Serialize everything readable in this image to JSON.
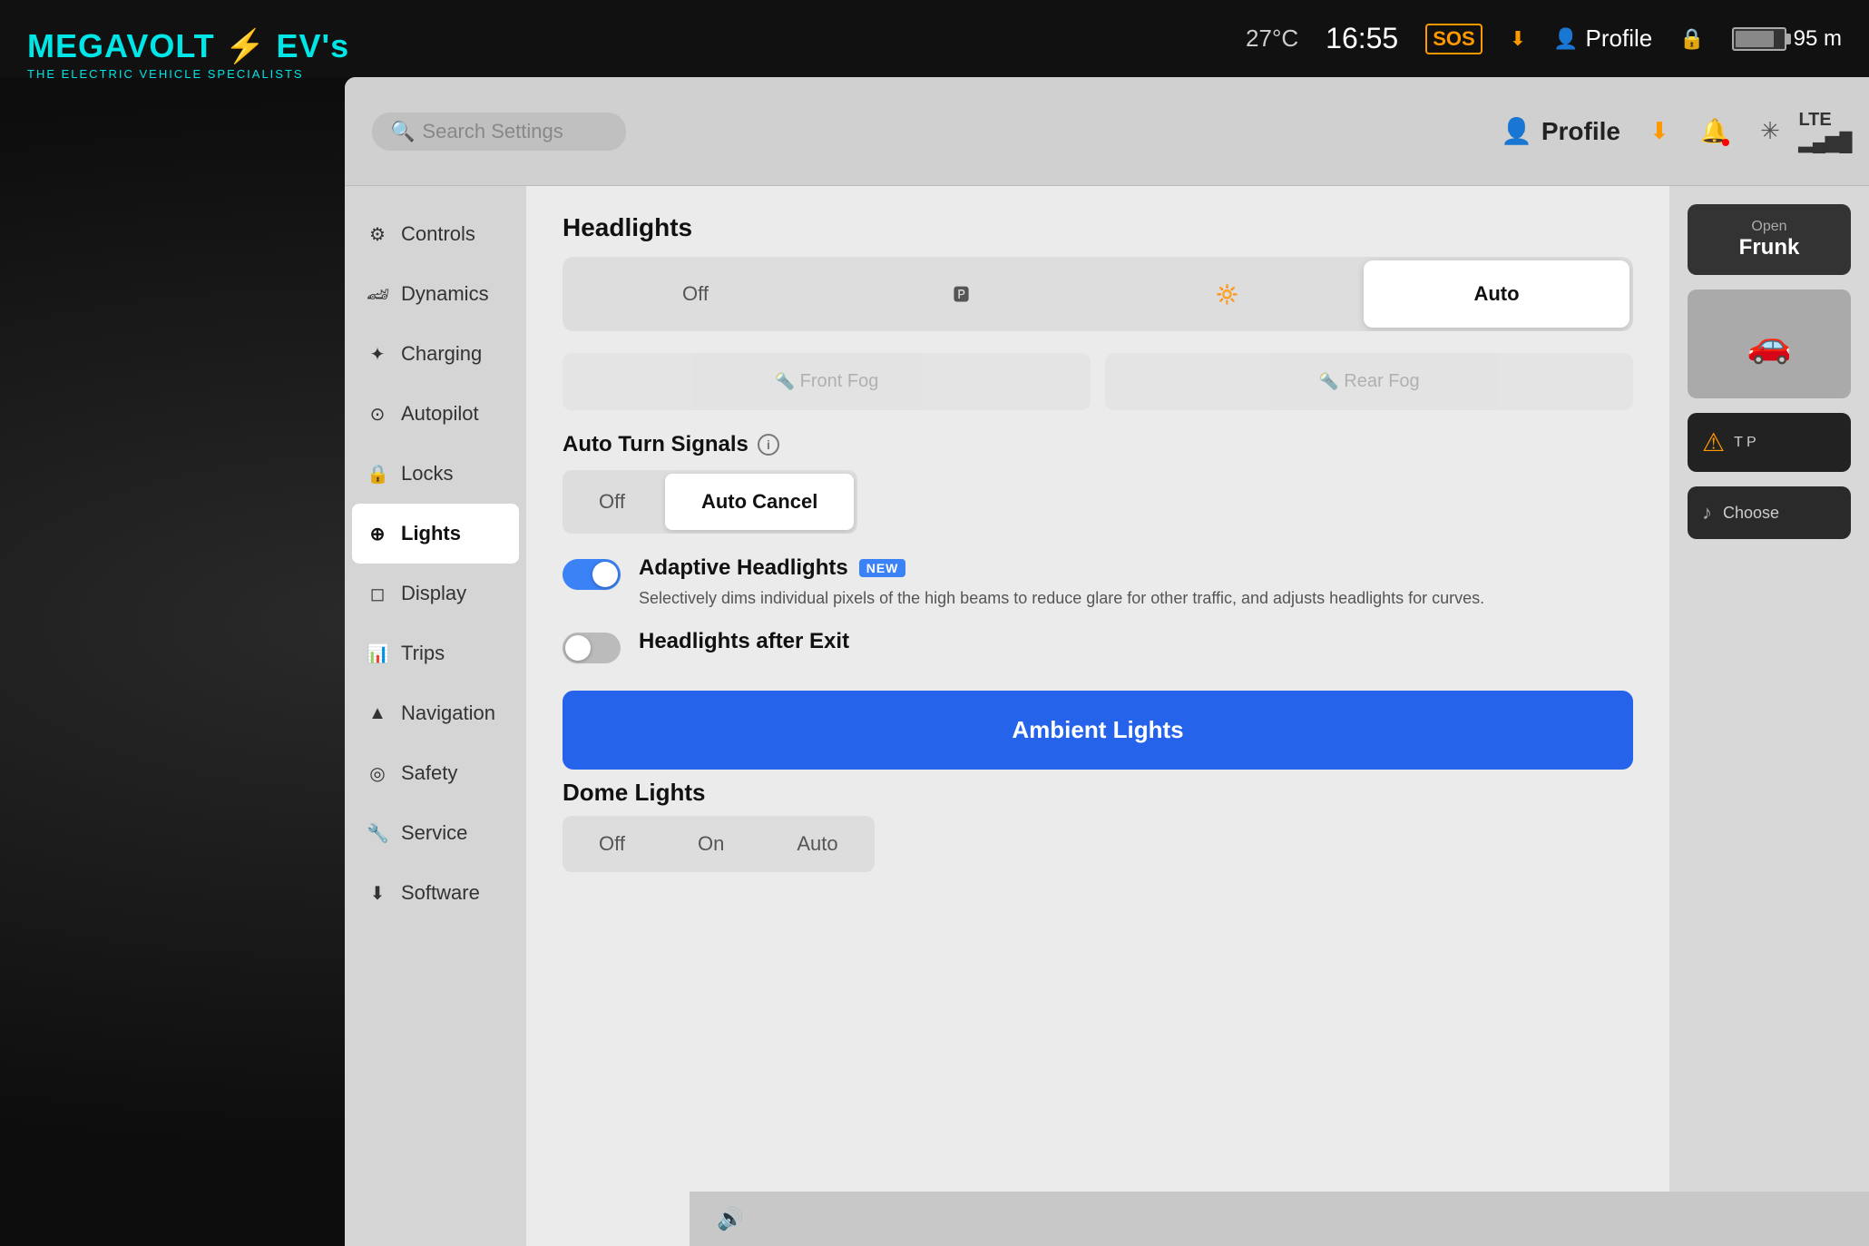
{
  "logo": {
    "brand": "MEGAVOLT ⚡ EV's",
    "subtitle": "THE ELECTRIC VEHICLE SPECIALISTS"
  },
  "status_bar": {
    "temperature": "27°C",
    "time": "16:55",
    "sos": "SOS",
    "profile": "Profile",
    "battery_pct": "95 m"
  },
  "tesla_header": {
    "search_placeholder": "Search Settings",
    "profile_label": "Profile",
    "icons": [
      "download-icon",
      "bell-icon",
      "bluetooth-icon",
      "signal-icon"
    ]
  },
  "sidebar": {
    "items": [
      {
        "id": "controls",
        "label": "Controls",
        "icon": "⚙"
      },
      {
        "id": "dynamics",
        "label": "Dynamics",
        "icon": "🏎"
      },
      {
        "id": "charging",
        "label": "Charging",
        "icon": "+"
      },
      {
        "id": "autopilot",
        "label": "Autopilot",
        "icon": "🛞"
      },
      {
        "id": "locks",
        "label": "Locks",
        "icon": "🔒"
      },
      {
        "id": "lights",
        "label": "Lights",
        "icon": "💡",
        "active": true
      },
      {
        "id": "display",
        "label": "Display",
        "icon": "🖥"
      },
      {
        "id": "trips",
        "label": "Trips",
        "icon": "📊"
      },
      {
        "id": "navigation",
        "label": "Navigation",
        "icon": "🧭"
      },
      {
        "id": "safety",
        "label": "Safety",
        "icon": "🛡"
      },
      {
        "id": "service",
        "label": "Service",
        "icon": "🔧"
      },
      {
        "id": "software",
        "label": "Software",
        "icon": "⬇"
      }
    ]
  },
  "lights_panel": {
    "headlights_title": "Headlights",
    "headlights_options": [
      {
        "id": "off",
        "label": "Off",
        "active": false
      },
      {
        "id": "parking",
        "label": "🅿",
        "active": false
      },
      {
        "id": "low",
        "label": "🔆",
        "active": false
      },
      {
        "id": "auto",
        "label": "Auto",
        "active": true
      }
    ],
    "fog_options": [
      {
        "id": "front_fog",
        "label": "Front Fog",
        "disabled": true
      },
      {
        "id": "rear_fog",
        "label": "Rear Fog",
        "disabled": true
      }
    ],
    "auto_turn_signals_title": "Auto Turn Signals",
    "auto_turn_options": [
      {
        "id": "off",
        "label": "Off",
        "active": false
      },
      {
        "id": "auto_cancel",
        "label": "Auto Cancel",
        "active": true
      }
    ],
    "adaptive_headlights_title": "Adaptive Headlights",
    "adaptive_headlights_badge": "NEW",
    "adaptive_headlights_desc": "Selectively dims individual pixels of the high beams to reduce glare for other traffic, and adjusts headlights for curves.",
    "adaptive_headlights_on": true,
    "headlights_after_exit_title": "Headlights after Exit",
    "headlights_after_exit_on": false,
    "ambient_lights_btn": "Ambient Lights",
    "dome_lights_title": "Dome Lights",
    "dome_options": [
      {
        "id": "off",
        "label": "Off"
      },
      {
        "id": "on",
        "label": "On"
      },
      {
        "id": "auto",
        "label": "Auto"
      }
    ]
  },
  "right_panel": {
    "frunk_open_label": "Open",
    "frunk_label": "Frunk",
    "warning_text": "T P",
    "choose_label": "Choose"
  },
  "bottom_bar": {
    "sound_icon": "🔊"
  }
}
